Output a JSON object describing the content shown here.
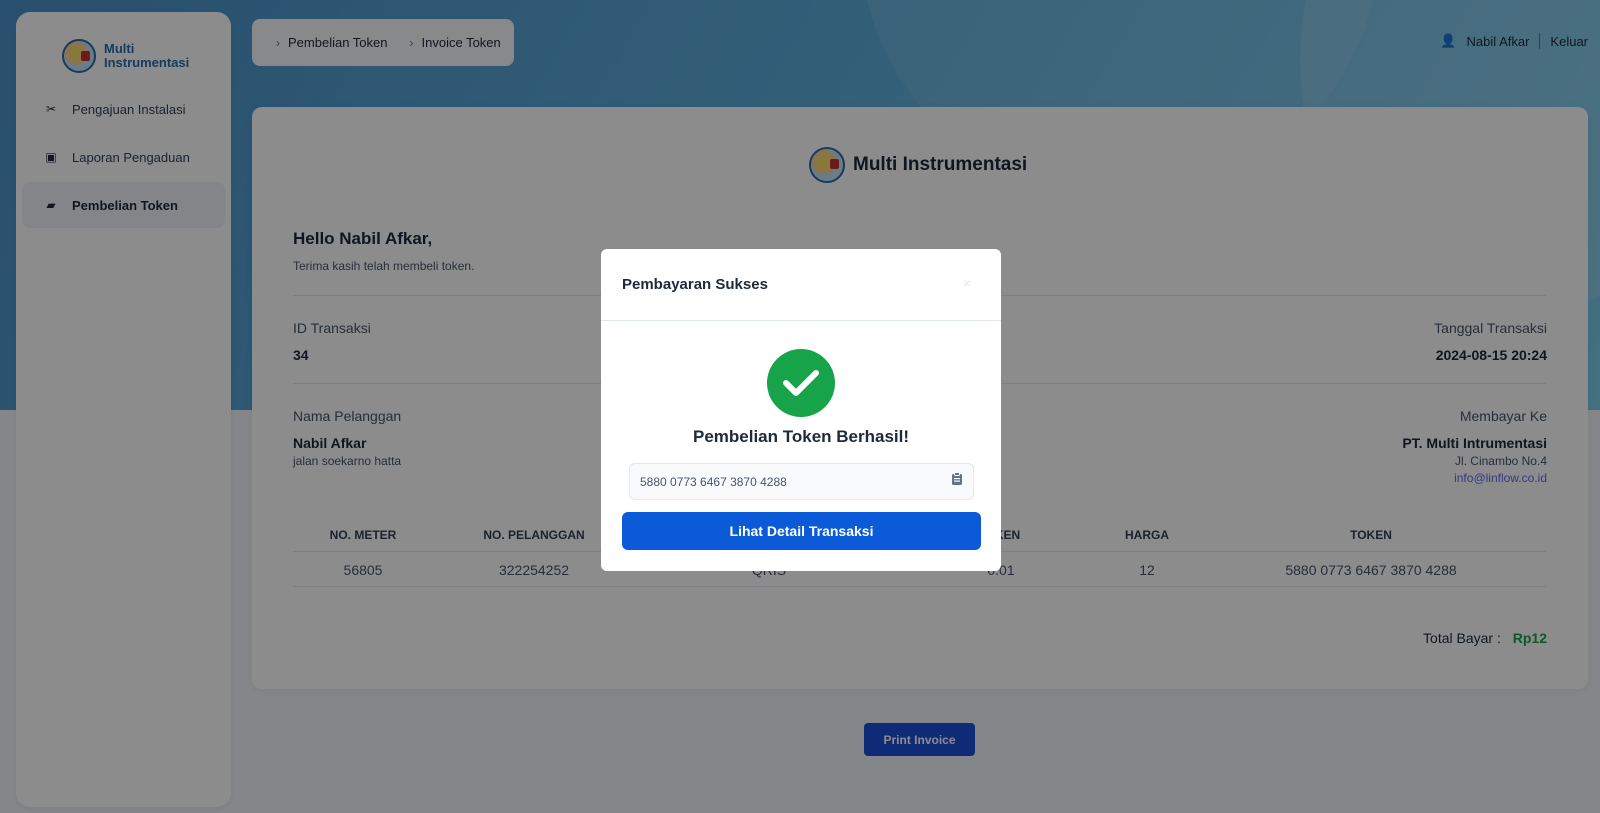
{
  "colors": {
    "primary": "#0b5bd8",
    "success": "#16a34a",
    "brand": "#2b6cb0",
    "link": "#6366f1"
  },
  "sidebar": {
    "brand": "Multi Instrumentasi",
    "items": [
      {
        "label": "Pengajuan Instalasi",
        "icon": "tools-icon",
        "active": false
      },
      {
        "label": "Laporan Pengaduan",
        "icon": "report-icon",
        "active": false
      },
      {
        "label": "Pembelian Token",
        "icon": "token-icon",
        "active": true
      }
    ]
  },
  "breadcrumb": {
    "items": [
      "Pembelian Token",
      "Invoice Token"
    ]
  },
  "header": {
    "user_name": "Nabil Afkar",
    "logout": "Keluar"
  },
  "invoice": {
    "brand": "Multi Instrumentasi",
    "greeting": "Hello Nabil Afkar,",
    "thanks": "Terima kasih telah membeli token.",
    "transaction_id_label": "ID Transaksi",
    "transaction_id": "34",
    "transaction_date_label": "Tanggal Transaksi",
    "transaction_date": "2024-08-15 20:24",
    "customer_label": "Nama Pelanggan",
    "customer_name": "Nabil Afkar",
    "customer_address": "jalan soekarno hatta",
    "payee_label": "Membayar Ke",
    "payee_name": "PT. Multi Intrumentasi",
    "payee_address": "Jl. Cinambo No.4",
    "payee_email": "info@linflow.co.id",
    "table": {
      "headers": [
        "NO. METER",
        "NO. PELANGGAN",
        "",
        "I TOKEN",
        "HARGA",
        "TOKEN"
      ],
      "row": [
        "56805",
        "322254252",
        "QRIS",
        "0.01",
        "12",
        "5880 0773 6467 3870 4288"
      ]
    },
    "total_label": "Total Bayar :",
    "total_value": "Rp12",
    "print_label": "Print Invoice"
  },
  "modal": {
    "title": "Pembayaran Sukses",
    "close": "×",
    "message": "Pembelian Token Berhasil!",
    "token": "5880 0773 6467 3870 4288",
    "detail_button": "Lihat Detail Transaksi"
  }
}
